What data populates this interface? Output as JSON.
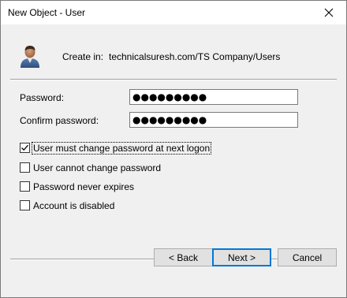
{
  "window": {
    "title": "New Object - User",
    "close_glyph": "✕"
  },
  "header": {
    "icon": "user-icon",
    "create_in_label": "Create in:",
    "create_in_path": "technicalsuresh.com/TS Company/Users"
  },
  "form": {
    "password_label": "Password:",
    "password_value": "●●●●●●●●●",
    "confirm_label": "Confirm password:",
    "confirm_value": "●●●●●●●●●"
  },
  "options": [
    {
      "label": "User must change password at next logon",
      "checked": true
    },
    {
      "label": "User cannot change password",
      "checked": false
    },
    {
      "label": "Password never expires",
      "checked": false
    },
    {
      "label": "Account is disabled",
      "checked": false
    }
  ],
  "buttons": {
    "back": "< Back",
    "next": "Next >",
    "cancel": "Cancel"
  },
  "colors": {
    "accent": "#0078d7",
    "dialog_bg": "#f0f0f0"
  }
}
